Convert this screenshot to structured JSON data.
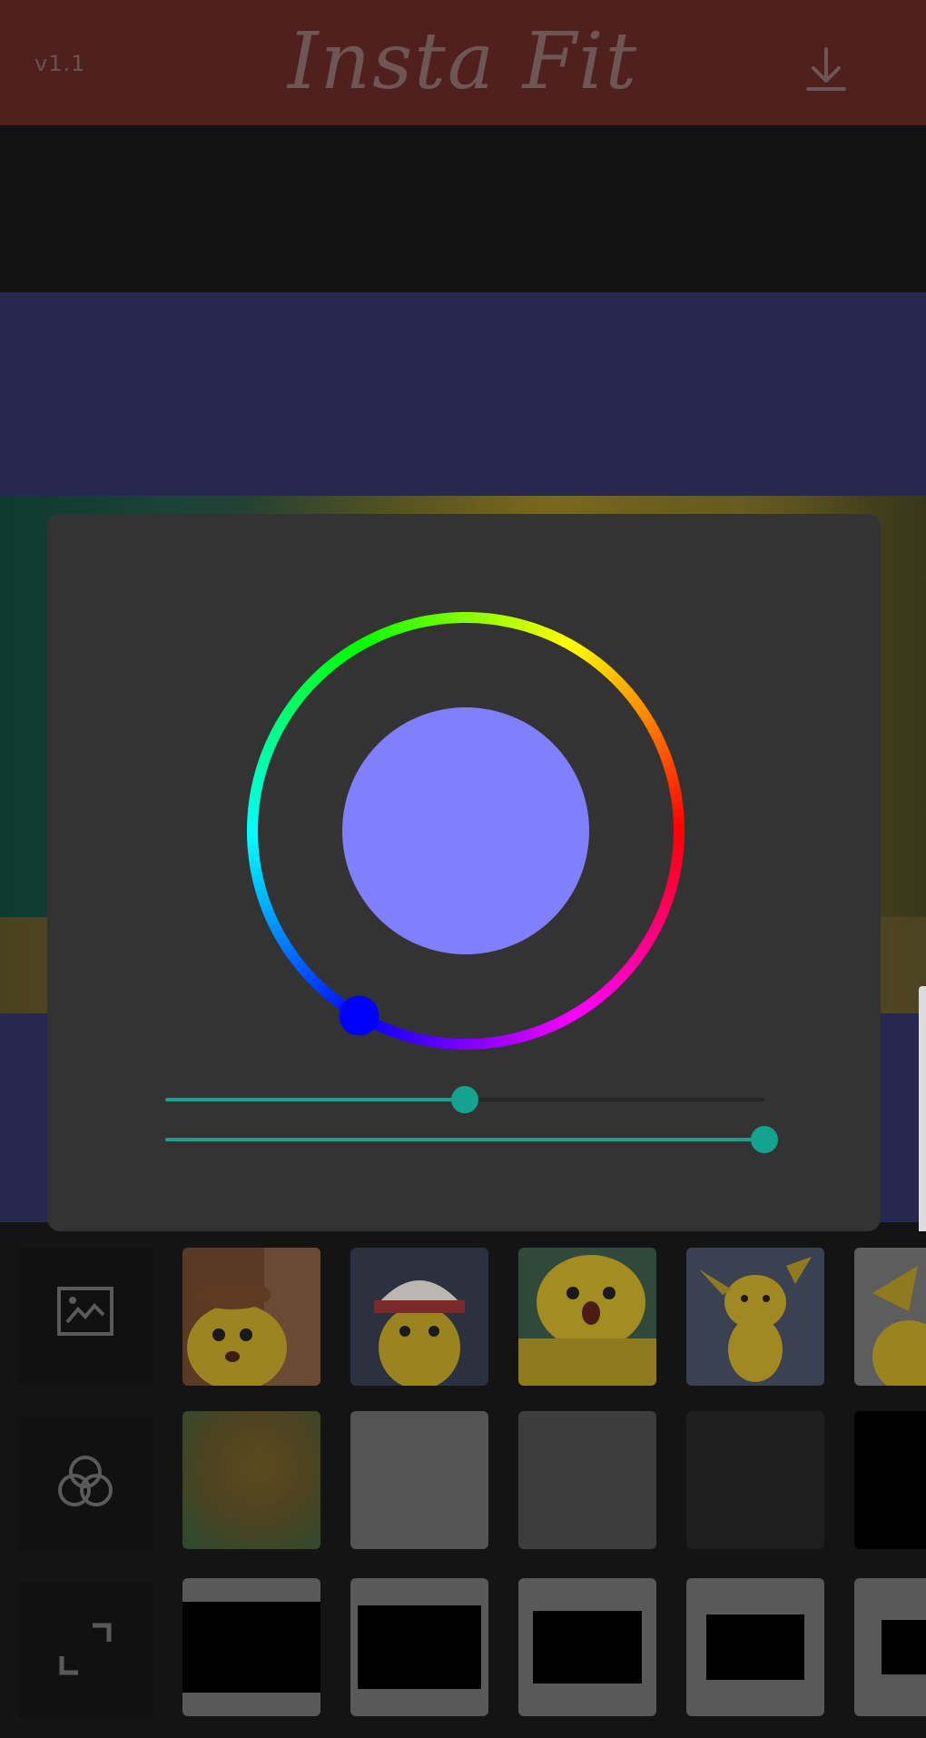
{
  "app": {
    "version": "v1.1",
    "title": "Insta Fit",
    "accent": "#14a38e",
    "topbar_color": "#4f201d",
    "selected_color": "#8080ff"
  },
  "color_picker": {
    "selected_hex": "#8080ff",
    "hue_handle_color": "#0000ff",
    "slider1_value": 0.5,
    "slider2_value": 1.0
  },
  "toolbar": {
    "download_icon": "download-icon",
    "background_icon": "image-icon",
    "blur_icon": "overlapping-circles-icon",
    "resize_icon": "expand-icon"
  },
  "backgrounds": {
    "colors": [
      "#4e4320",
      "#545454",
      "#3d3d3d",
      "#1f1f1f",
      "#000000"
    ]
  }
}
